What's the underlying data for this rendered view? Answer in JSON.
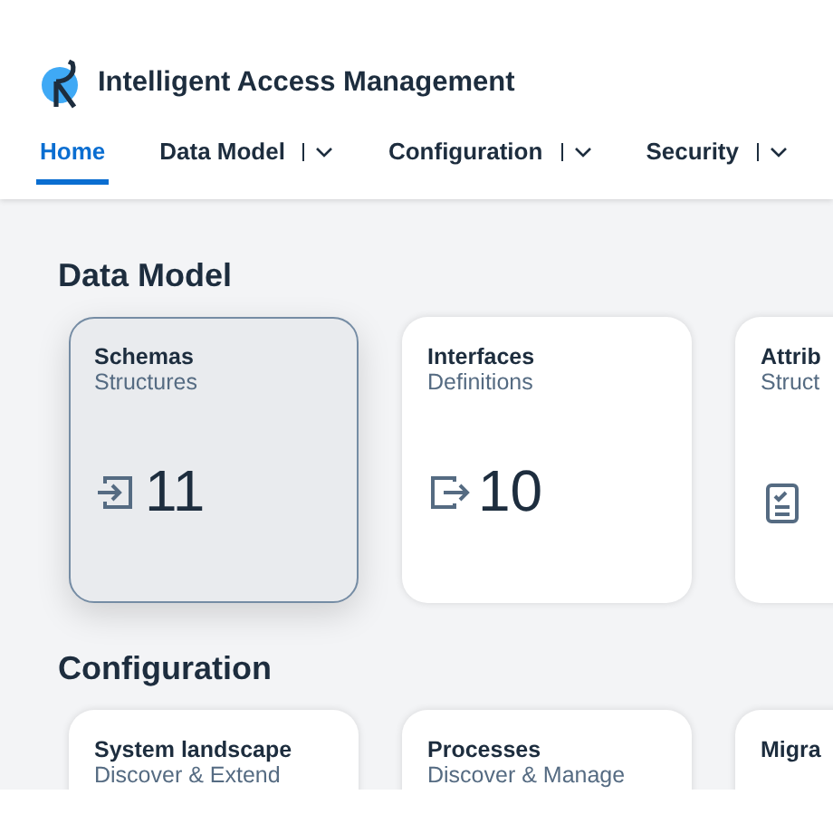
{
  "app": {
    "title": "Intelligent Access Management"
  },
  "nav": [
    {
      "label": "Home",
      "selected": true,
      "has_menu": false
    },
    {
      "label": "Data Model",
      "selected": false,
      "has_menu": true
    },
    {
      "label": "Configuration",
      "selected": false,
      "has_menu": true
    },
    {
      "label": "Security",
      "selected": false,
      "has_menu": true
    }
  ],
  "sections": [
    {
      "title": "Data Model",
      "tiles": [
        {
          "title": "Schemas",
          "subtitle": "Structures",
          "kind": "enter",
          "count": "11",
          "selected": true
        },
        {
          "title": "Interfaces",
          "subtitle": "Definitions",
          "kind": "exit",
          "count": "10",
          "selected": false
        },
        {
          "title": "Attrib",
          "subtitle": "Struct",
          "kind": "checklist",
          "selected": false
        }
      ]
    },
    {
      "title": "Configuration",
      "tiles": [
        {
          "title": "System landscape",
          "subtitle": "Discover & Extend",
          "selected": false
        },
        {
          "title": "Processes",
          "subtitle": "Discover & Manage",
          "selected": false
        },
        {
          "title": "Migra",
          "selected": false
        }
      ]
    }
  ]
}
